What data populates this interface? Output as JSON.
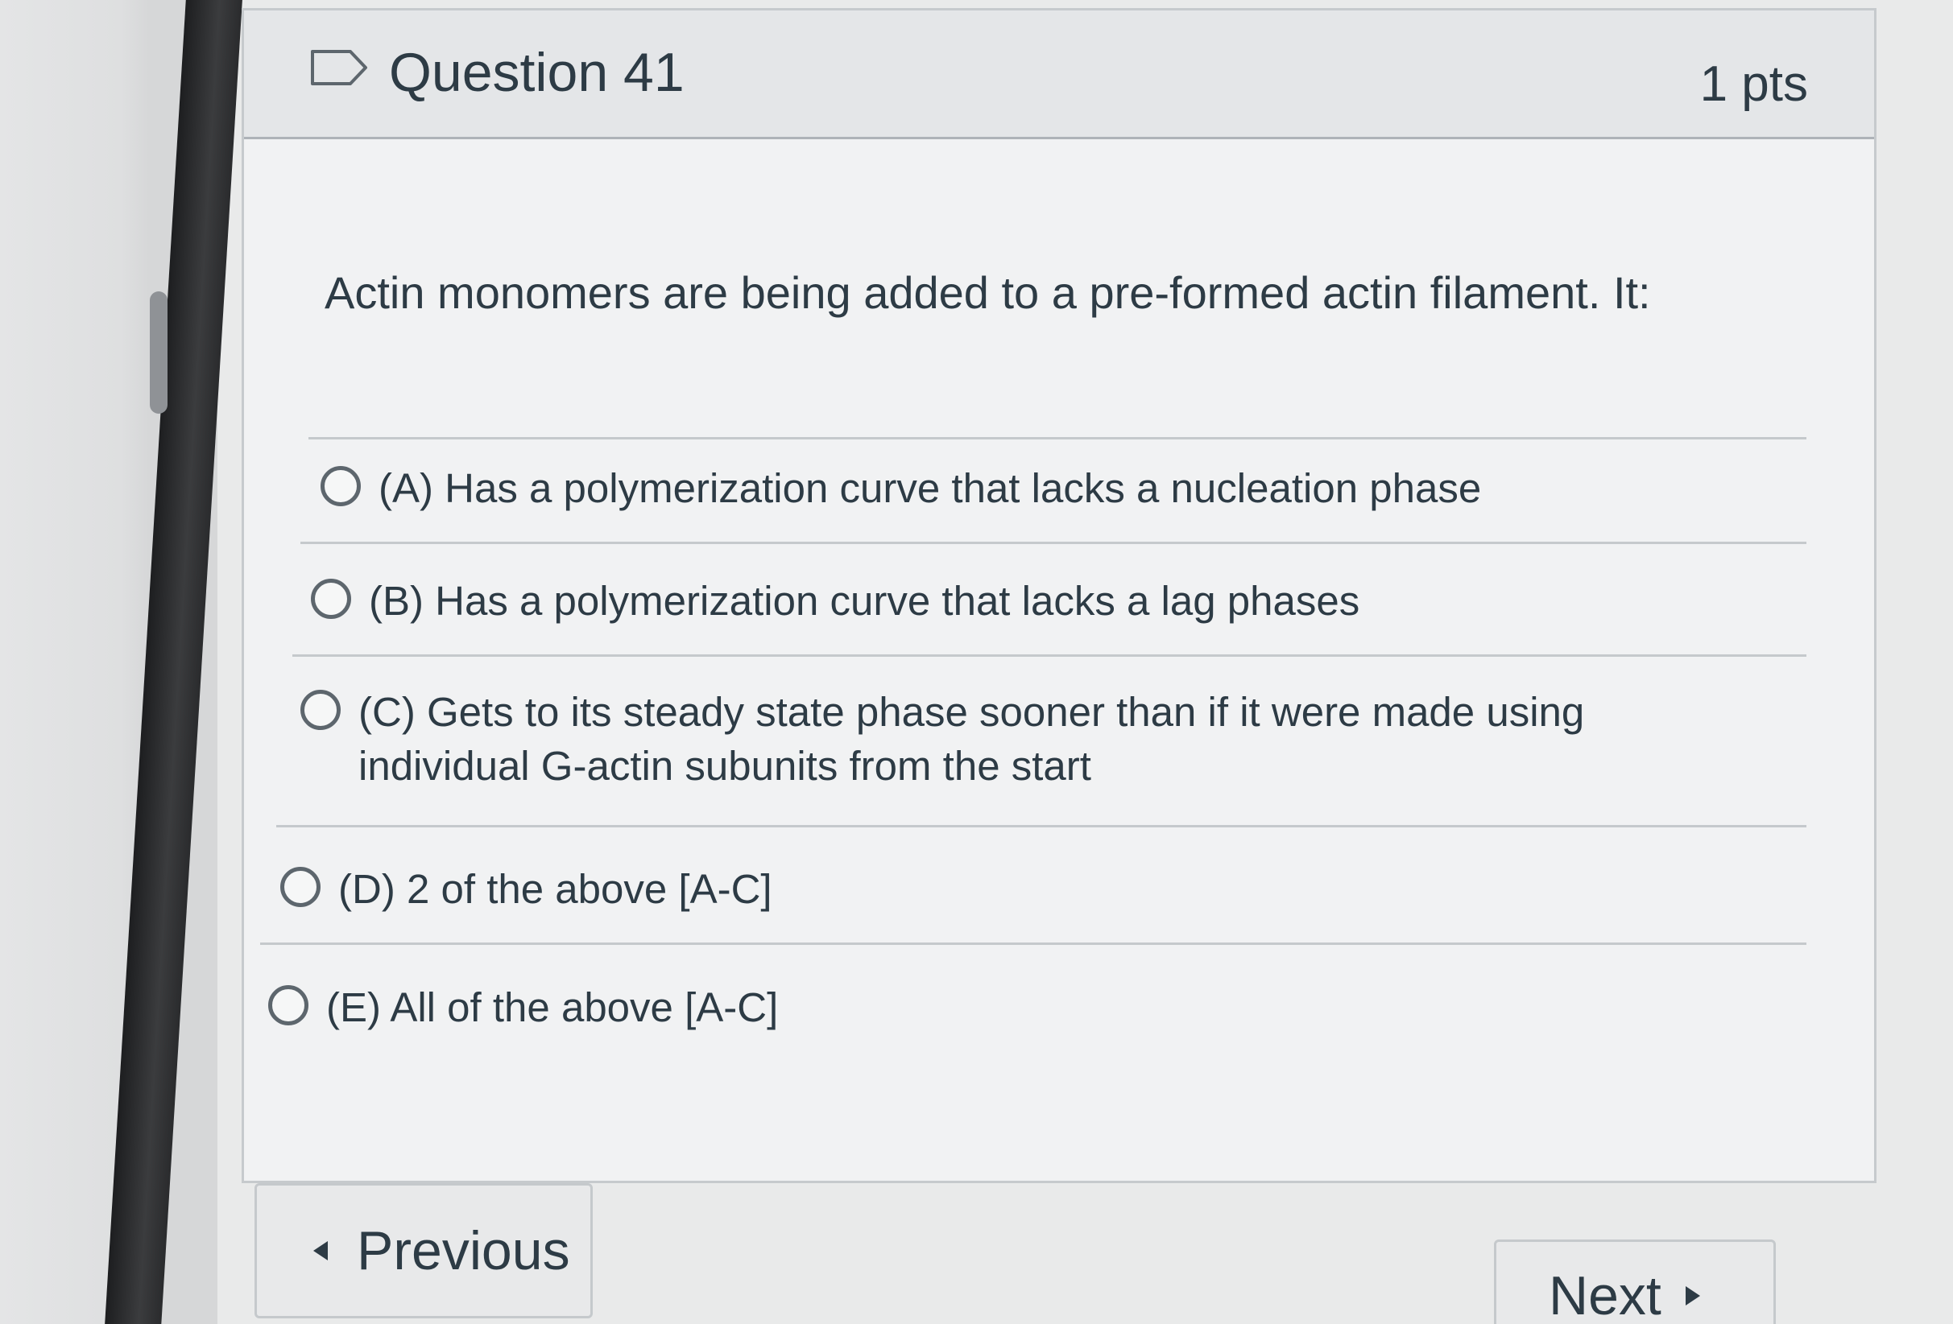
{
  "question": {
    "title": "Question 41",
    "points": "1 pts",
    "text": "Actin monomers are being added to a pre-formed actin filament. It:"
  },
  "answers": [
    {
      "label": "(A) Has a polymerization curve that lacks a nucleation phase"
    },
    {
      "label": "(B) Has a polymerization curve that lacks a lag phases"
    },
    {
      "label": "(C) Gets to its steady state phase sooner than if it were made using individual G-actin subunits from the start"
    },
    {
      "label": "(D) 2 of the above [A-C]"
    },
    {
      "label": "(E) All of the above [A-C]"
    }
  ],
  "navigation": {
    "previous_label": "Previous",
    "next_label": "Next"
  },
  "icons": {
    "flag": "flag-outline-icon",
    "previous": "triangle-left-icon",
    "next": "triangle-right-icon"
  }
}
